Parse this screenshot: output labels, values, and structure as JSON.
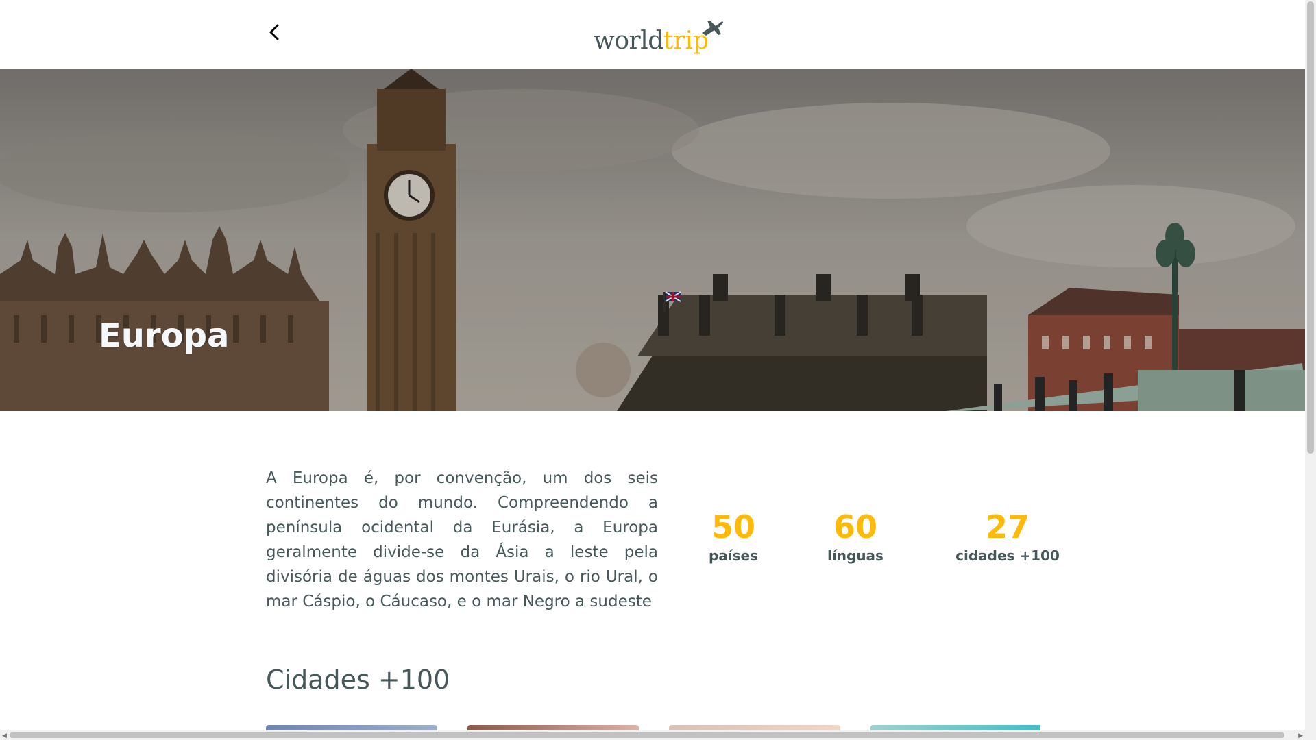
{
  "header": {
    "back_icon": "chevron-left-icon",
    "logo_world": "world",
    "logo_trip": "trip",
    "logo_icon": "airplane-icon",
    "colors": {
      "dark": "#47585b",
      "accent": "#ffba08"
    }
  },
  "banner": {
    "title": "Europa"
  },
  "continent": {
    "description": "A Europa é, por convenção, um dos seis continentes do mundo. Compreendendo a península ocidental da Eurásia, a Europa geralmente divide-se da Ásia a leste pela divisória de águas dos montes Urais, o rio Ural, o mar Cáspio, o Cáucaso, e o mar Negro a sudeste",
    "stats": [
      {
        "number": "50",
        "label": "países"
      },
      {
        "number": "60",
        "label": "línguas"
      },
      {
        "number": "27",
        "label": "cidades +100"
      }
    ]
  },
  "cities_section": {
    "title": "Cidades +100"
  }
}
